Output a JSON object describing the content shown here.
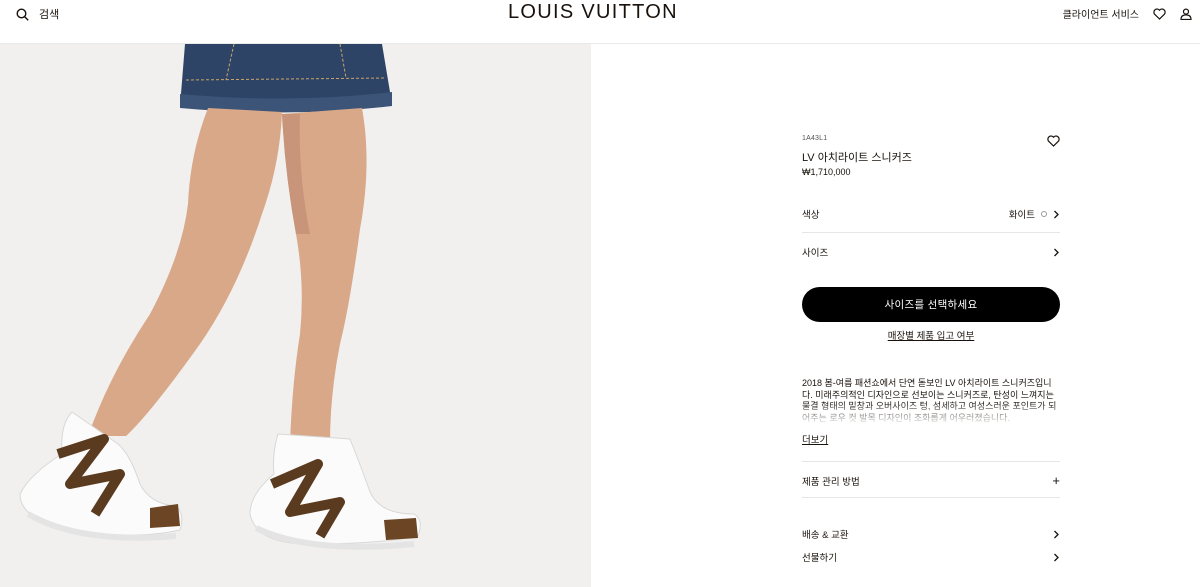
{
  "header": {
    "search_label": "검색",
    "brand": "LOUIS VUITTON",
    "client_service": "클라이언트 서비스"
  },
  "product": {
    "sku": "1A43L1",
    "name": "LV 아치라이트 스니커즈",
    "price": "₩1,710,000",
    "color_label": "색상",
    "color_value": "화이트",
    "size_label": "사이즈",
    "cta_label": "사이즈를 선택하세요",
    "store_link": "매장별 제품 입고 여부",
    "description": "2018 봄-여름 패션쇼에서 단연 돋보인 LV 아치라이트 스니커즈입니다. 미래주의적인 디자인으로 선보이는 스니커즈로, 탄성이 느껴지는 물결 형태의 밑창과 오버사이즈 텅, 섬세하고 여성스러운 포인트가 되어주는 로우 컷 발목 디자인이 조화롭게 어우러졌습니다.",
    "more_label": "더보기",
    "care_label": "제품 관리 방법",
    "shipping_label": "배송 & 교환",
    "gift_label": "선물하기"
  },
  "colors": {
    "accent": "#000000",
    "text": "#19110b",
    "background": "#f1f0ee"
  },
  "icons": [
    "search-icon",
    "heart-icon",
    "user-icon",
    "chevron-right-icon",
    "plus-icon"
  ]
}
